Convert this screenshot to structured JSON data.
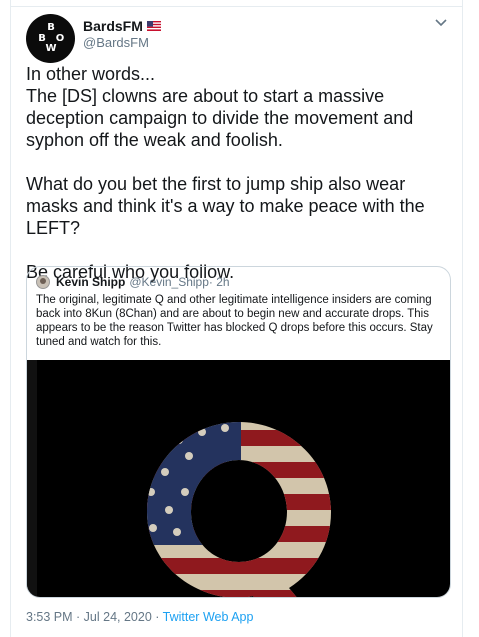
{
  "tweet": {
    "display_name": "BardsFM",
    "handle": "@BardsFM",
    "avatar_letters": [
      "B",
      "B",
      "O",
      "W"
    ],
    "body": "In other words...\nThe [DS] clowns are about to start a massive deception campaign to divide the movement and syphon off the weak and foolish.\n\nWhat do you bet the first to jump ship also wear masks and think it's a way to make peace with the LEFT?\n\nBe careful who you follow.",
    "footer_time": "3:53 PM · Jul 24, 2020 · ",
    "footer_app": "Twitter Web App"
  },
  "quoted": {
    "display_name": "Kevin Shipp",
    "handle": "@Kevin_Shipp",
    "time": " · 2h",
    "body": "The original, legitimate Q and other legitimate intelligence insiders are coming back into 8Kun (8Chan) and are about to begin new and accurate drops. This appears to be the reason Twitter has blocked Q drops before this occurs. Stay tuned and watch for this."
  },
  "icons": [
    "us-flag-icon",
    "chevron-down-icon"
  ],
  "colors": {
    "link": "#1da1f2",
    "muted": "#657786",
    "border": "#ccd6dd"
  }
}
